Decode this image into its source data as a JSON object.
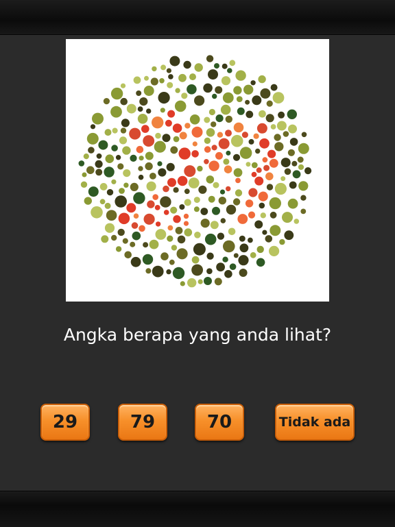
{
  "question": "Angka berapa yang anda lihat?",
  "answers": [
    "29",
    "79",
    "70",
    "Tidak ada"
  ],
  "colors": {
    "background": "#2b2b2b",
    "button_orange": "#f7902a",
    "plate_figure": [
      "#e03c28",
      "#f06a3a",
      "#f0833f",
      "#d84a30"
    ],
    "plate_background": [
      "#3a3a18",
      "#4c4a1d",
      "#6c6b25",
      "#8a9a34",
      "#a2b048",
      "#b8c35f",
      "#2e5a24"
    ]
  }
}
